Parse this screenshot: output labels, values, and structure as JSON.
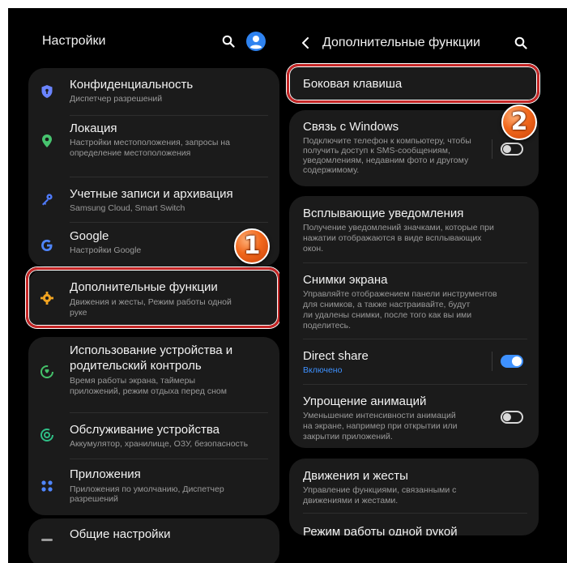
{
  "left": {
    "title": "Настройки",
    "items": [
      {
        "title": "Конфиденциальность",
        "subtitle": [
          "Диспетчер разрешений"
        ]
      },
      {
        "title": "Локация",
        "subtitle": [
          "Настройки местоположения, запросы на",
          "определение местоположения"
        ]
      },
      {
        "title": "Учетные записи и архивация",
        "subtitle": [
          "Samsung Cloud, Smart Switch"
        ]
      },
      {
        "title": "Google",
        "subtitle": [
          "Настройки Google"
        ]
      },
      {
        "title": "Дополнительные функции",
        "subtitle": [
          "Движения и жесты, Режим работы одной",
          "руке"
        ]
      },
      {
        "title": [
          "Использование устройства и",
          "родительский контроль"
        ],
        "subtitle": [
          "Время работы экрана, таймеры",
          "приложений, режим отдыха перед сном"
        ]
      },
      {
        "title": "Обслуживание устройства",
        "subtitle": [
          "Аккумулятор, хранилище, ОЗУ, безопасность"
        ]
      },
      {
        "title": "Приложения",
        "subtitle": [
          "Приложения по умолчанию, Диспетчер",
          "разрешений"
        ]
      },
      {
        "title": "Общие настройки",
        "subtitle": []
      }
    ]
  },
  "right": {
    "title": "Дополнительные функции",
    "items": [
      {
        "title": "Боковая клавиша",
        "subtitle": []
      },
      {
        "title": "Связь с Windows",
        "subtitle": [
          "Подключите телефон к компьютеру, чтобы",
          "получить доступ к SMS-сообщениям,",
          "уведомлениям, недавним фото и другому",
          "содержимому."
        ],
        "toggle": false
      },
      {
        "title": "Всплывающие уведомления",
        "subtitle": [
          "Получение уведомлений значками, которые при",
          "нажатии отображаются в виде всплывающих",
          "окон."
        ]
      },
      {
        "title": "Снимки экрана",
        "subtitle": [
          "Управляйте отображением панели инструментов",
          "для снимков, а также настраивайте, будут",
          "ли удалены снимки, после того как вы ими",
          "поделитесь."
        ]
      },
      {
        "title": "Direct share",
        "status": "Включено",
        "toggle": true
      },
      {
        "title": "Упрощение анимаций",
        "subtitle": [
          "Уменьшение интенсивности анимаций",
          "на экране, например при открытии или",
          "закрытии приложений."
        ],
        "toggle": false
      },
      {
        "title": "Движения и жесты",
        "subtitle": [
          "Управление функциями, связанными с",
          "движениями и жестами."
        ]
      },
      {
        "title": "Режим работы одной рукой",
        "subtitle": []
      }
    ]
  },
  "badges": [
    "1",
    "2"
  ],
  "colors": {
    "accent": "#3e91ff",
    "highlight": "#c42525",
    "badge": "#f2681c",
    "card": "#1b1b1b",
    "background": "#000000"
  },
  "icons": {
    "privacy": "shield-icon",
    "location": "location-pin-icon",
    "accounts": "key-icon",
    "google": "google-icon",
    "advanced": "puzzle-gear-icon",
    "wellbeing": "wellbeing-icon",
    "care": "device-care-icon",
    "apps": "apps-grid-icon"
  }
}
